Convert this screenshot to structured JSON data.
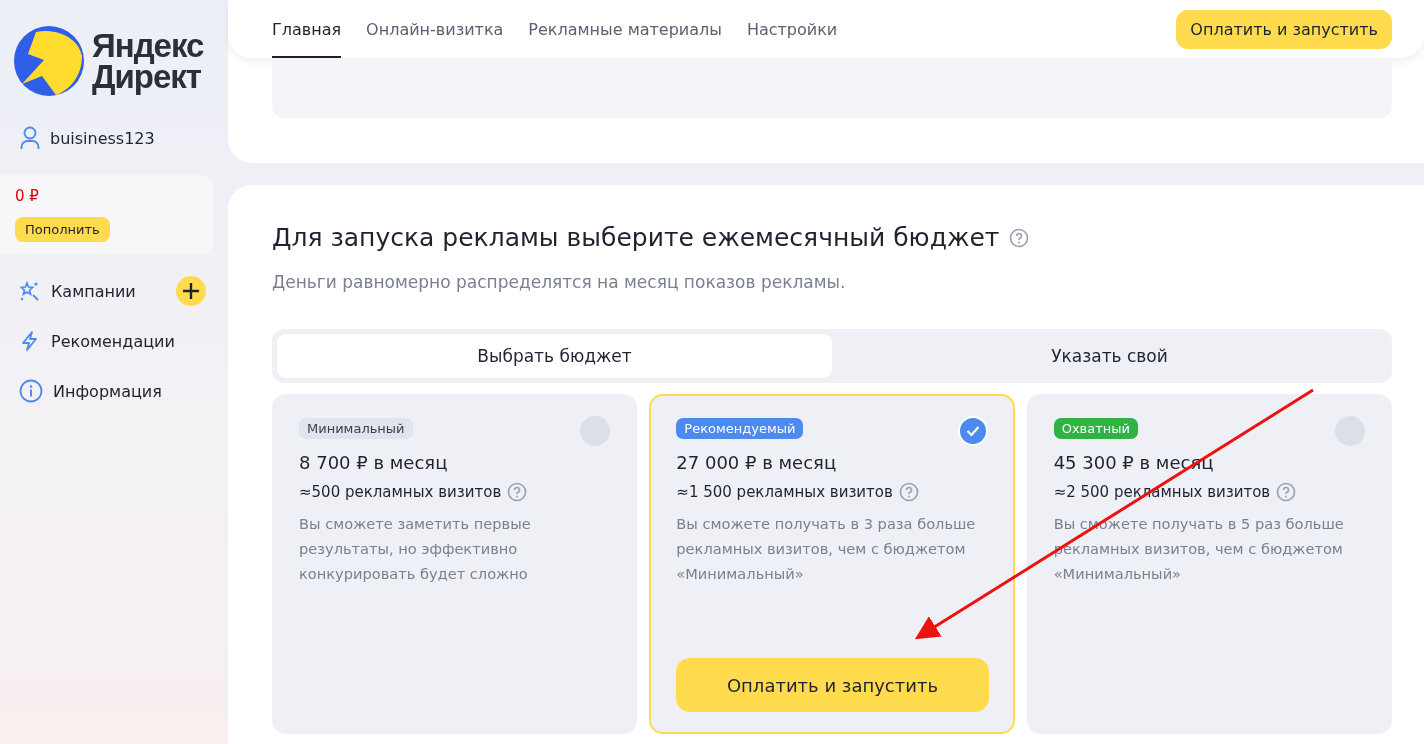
{
  "logo": {
    "line_1": "Яндекс",
    "line_2": "Директ"
  },
  "user": {
    "name": "buisiness123"
  },
  "balance": {
    "amount": "0 ₽",
    "button": "Пополнить"
  },
  "sidebar": {
    "items": [
      {
        "label": "Кампании",
        "kind": "campaigns",
        "add_button": true
      },
      {
        "label": "Рекомендации",
        "kind": "recommendations",
        "add_button": false
      },
      {
        "label": "Информация",
        "kind": "info",
        "add_button": false
      }
    ]
  },
  "nav": {
    "tabs": [
      {
        "label": "Главная",
        "selected": true
      },
      {
        "label": "Онлайн-визитка",
        "selected": false
      },
      {
        "label": "Рекламные материалы",
        "selected": false
      },
      {
        "label": "Настройки",
        "selected": false
      }
    ],
    "button": "Оплатить и запустить"
  },
  "budget": {
    "title": "Для запуска рекламы выберите ежемесячный бюджет",
    "subtitle": "Деньги равномерно распределятся на месяц показов рекламы.",
    "modes": [
      {
        "label": "Выбрать бюджет",
        "selected": true
      },
      {
        "label": "Указать свой",
        "selected": false
      }
    ],
    "cards": [
      {
        "badge": "Минимальный",
        "color": "#e0e4ee",
        "price": "8 700 ₽ в месяц",
        "visits": "≈500 рекламных визитов",
        "description": "Вы сможете заметить первые результаты, но эффективно конкурировать будет сложно",
        "selected": false
      },
      {
        "badge": "Рекомендуемый",
        "color": "#4d8af0",
        "price": "27 000 ₽ в месяц",
        "visits": "≈1 500 рекламных визитов",
        "description": "Вы сможете получать в 3 раза больше рекламных визитов, чем с бюджетом «Минимальный»",
        "selected": true,
        "button": "Оплатить и запустить"
      },
      {
        "badge": "Охватный",
        "color": "#2fb344",
        "price": "45 300 ₽ в месяц",
        "visits": "≈2 500 рекламных визитов",
        "description": "Вы сможете получать в 5 раз больше рекламных визитов, чем с бюджетом «Минимальный»",
        "selected": false
      }
    ]
  }
}
